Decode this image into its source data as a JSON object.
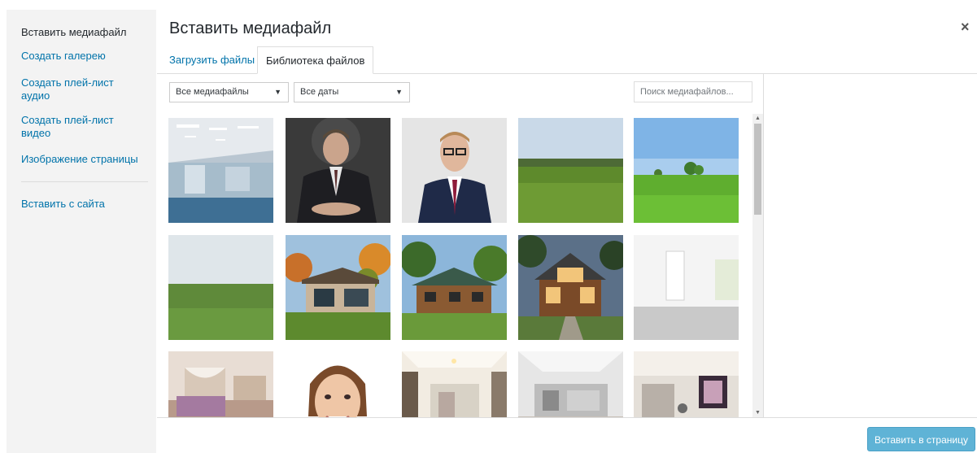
{
  "menu": {
    "items": [
      {
        "label": "Вставить медиафайл"
      },
      {
        "label": "Создать галерею"
      },
      {
        "label": "Создать плей-лист аудио"
      },
      {
        "label": "Создать плей-лист видео"
      },
      {
        "label": "Изображение страницы"
      },
      {
        "label": "Вставить с сайта"
      }
    ]
  },
  "modal": {
    "title": "Вставить медиафайл",
    "close": "×"
  },
  "tabs": [
    {
      "label": "Загрузить файлы"
    },
    {
      "label": "Библиотека файлов"
    }
  ],
  "filters": {
    "type_value": "Все медиафайлы",
    "date_value": "Все даты",
    "search_placeholder": "Поиск медиафайлов..."
  },
  "footer": {
    "insert_label": "Вставить в страницу"
  },
  "colors": {
    "accent": "#0073aa",
    "button": "#5fb3d6"
  }
}
